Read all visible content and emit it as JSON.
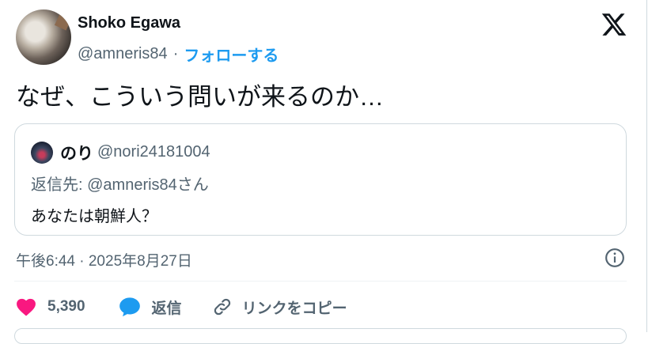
{
  "header": {
    "display_name": "Shoko Egawa",
    "handle": "@amneris84",
    "separator": "·",
    "follow_label": "フォローする"
  },
  "tweet": {
    "text": "なぜ、こういう問いが来るのか…"
  },
  "quote": {
    "display_name": "のり",
    "handle": "@nori24181004",
    "reply_to": "返信先: @amneris84さん",
    "text": "あなたは朝鮮人？"
  },
  "meta": {
    "timestamp": "午後6:44 · 2025年8月27日"
  },
  "actions": {
    "like_count": "5,390",
    "reply_label": "返信",
    "copy_link_label": "リンクをコピー"
  },
  "colors": {
    "accent": "#1d9bf0",
    "like": "#f91880",
    "secondary_text": "#536471",
    "border": "#cfd9de"
  },
  "icons": [
    "x-logo-icon",
    "info-icon",
    "heart-icon",
    "reply-bubble-icon",
    "link-icon"
  ]
}
